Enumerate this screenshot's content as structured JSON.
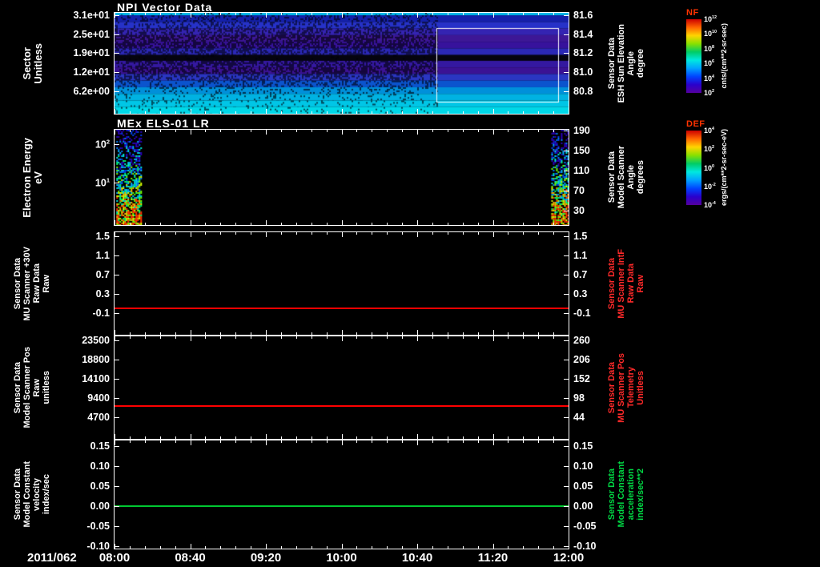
{
  "colors": {
    "background": "#000000",
    "axis_text": "#ffffff",
    "red_label": "#ff2a2a",
    "green_label": "#00d844",
    "colorbar_title": "#ff3300"
  },
  "chart_data": {
    "type": "heatmap",
    "description_type": "multi-panel time-series: 2 spectrograms + 3 constant line plots",
    "xaxis": {
      "date_label": "2011/062",
      "ticks": [
        "08:00",
        "08:40",
        "09:20",
        "10:00",
        "10:40",
        "11:20",
        "12:00"
      ]
    },
    "panels": [
      {
        "type": "spectrogram",
        "title": "NPI Vector Data",
        "left_label_lines": [
          "Sector",
          "Unitless"
        ],
        "left_ticks": [
          "3.1e+01",
          "2.5e+01",
          "1.9e+01",
          "1.2e+01",
          "6.2e+00"
        ],
        "right_ticks": [
          "81.6",
          "81.4",
          "81.2",
          "81.0",
          "80.8"
        ],
        "right_label_lines": [
          "Sensor Data",
          "ESH Sun Elevation",
          "Angle",
          "degree"
        ],
        "right_label_color": "#ffffff",
        "noise_end_frac": 0.709,
        "overlay_box": {
          "x1": 0.709,
          "x2": 0.977,
          "y1": 0.151,
          "y2": 0.881,
          "color": "#ffffff"
        },
        "bands": [
          {
            "color": "#00b8e8",
            "noise": 0.1,
            "h": 3
          },
          {
            "color": "#1420aa",
            "noise": 0.3,
            "h": 8
          },
          {
            "color": "#2632c8",
            "noise": 0.32,
            "h": 8
          },
          {
            "color": "#3424b2",
            "noise": 0.45,
            "h": 8
          },
          {
            "color": "#3d1796",
            "noise": 0.62,
            "h": 8
          },
          {
            "color": "#37129c",
            "noise": 0.62,
            "h": 8
          },
          {
            "color": "#2b28b6",
            "noise": 0.5,
            "h": 8
          },
          {
            "color": "#05040f",
            "noise": 0.05,
            "h": 7
          },
          {
            "color": "#3418a0",
            "noise": 0.55,
            "h": 8
          },
          {
            "color": "#3b1294",
            "noise": 0.62,
            "h": 8
          },
          {
            "color": "#2a36c2",
            "noise": 0.45,
            "h": 8
          },
          {
            "color": "#0b54ce",
            "noise": 0.3,
            "h": 8
          },
          {
            "color": "#0090da",
            "noise": 0.2,
            "h": 8
          },
          {
            "color": "#00b2e2",
            "noise": 0.15,
            "h": 8
          },
          {
            "color": "#00c6e6",
            "noise": 0.12,
            "h": 8
          },
          {
            "color": "#00d8e8",
            "noise": 0.1,
            "h": 8
          }
        ]
      },
      {
        "type": "spectrogram",
        "title": "MEx ELS-01 LR",
        "left_label_lines": [
          "Electron Energy",
          "eV"
        ],
        "left_ticks": [
          "10^2",
          "10^1"
        ],
        "right_ticks": [
          "190",
          "150",
          "110",
          "70",
          "30"
        ],
        "right_label_lines": [
          "Sensor Data",
          "Model Scanner",
          "Angle",
          "degrees"
        ],
        "right_label_color": "#ffffff",
        "background": "#000000",
        "palette": [
          "#2a00bb",
          "#0040ee",
          "#0080ff",
          "#00b8ff",
          "#00e8e0",
          "#00ff70",
          "#70ff00",
          "#d8ff00",
          "#ffb000",
          "#ff3000"
        ],
        "noise_columns": [
          {
            "x1": 0.004,
            "x2": 0.058
          },
          {
            "x1": 0.962,
            "x2": 0.998
          }
        ]
      },
      {
        "type": "line",
        "left_label_lines": [
          "Sensor Data",
          "MU Scanner +30V",
          "Raw Data",
          "Raw"
        ],
        "left_ticks": [
          "1.5",
          "1.1",
          "0.7",
          "0.3",
          "-0.1"
        ],
        "right_ticks": [
          "1.5",
          "1.1",
          "0.7",
          "0.3",
          "-0.1"
        ],
        "right_label_lines": [
          "Sensor Data",
          "MU Scanner IntF",
          "Raw Data",
          "Raw"
        ],
        "right_label_color": "#ff2a2a",
        "line": {
          "value": 0.0,
          "color": "#ff0000"
        }
      },
      {
        "type": "line",
        "left_label_lines": [
          "Sensor Data",
          "Model Scanner Pos",
          "Raw",
          "unitless"
        ],
        "left_ticks": [
          "23500",
          "18800",
          "14100",
          "9400",
          "4700"
        ],
        "right_ticks": [
          "260",
          "206",
          "152",
          "98",
          "44"
        ],
        "right_label_lines": [
          "Sensor Data",
          "MU Scanner Pos",
          "Telemetry",
          "Unitless"
        ],
        "right_label_color": "#ff2a2a",
        "line": {
          "value": 7500,
          "color": "#ff0000"
        }
      },
      {
        "type": "line",
        "left_label_lines": [
          "Sensor Data",
          "Model Constant",
          "velocity",
          "index/sec"
        ],
        "left_ticks": [
          "0.15",
          "0.10",
          "0.05",
          "0.00",
          "-0.05",
          "-0.10"
        ],
        "right_ticks": [
          "0.15",
          "0.10",
          "0.05",
          "0.00",
          "-0.05",
          "-0.10"
        ],
        "right_label_lines": [
          "Sensor Data",
          "Model Constant",
          "acceleration",
          "index/sec**2"
        ],
        "right_label_color": "#00d844",
        "line": {
          "value": 0.0,
          "color": "#00c832"
        }
      }
    ],
    "colorbars": [
      {
        "title": "NF",
        "title_color": "#ff3300",
        "units": "cnts/(cm**2-sr-sec)",
        "ticks": [
          "10^12",
          "10^10",
          "10^8",
          "10^6",
          "10^4",
          "10^2"
        ],
        "gradient": [
          "#cc0000",
          "#ff6600",
          "#ffd400",
          "#88e000",
          "#00cc66",
          "#00e8e0",
          "#00a2ff",
          "#0044ff",
          "#2a00cc",
          "#55009e"
        ]
      },
      {
        "title": "DEF",
        "title_color": "#ff3300",
        "units": "ergs/(cm**2-sr-sec-eV)",
        "ticks": [
          "10^4",
          "10^2",
          "10^0",
          "10^-2",
          "10^-4"
        ],
        "gradient": [
          "#cc0000",
          "#ff6600",
          "#ffd400",
          "#88e000",
          "#00cc66",
          "#00e8e0",
          "#00a2ff",
          "#0044ff",
          "#2a00cc",
          "#55009e"
        ]
      }
    ]
  }
}
